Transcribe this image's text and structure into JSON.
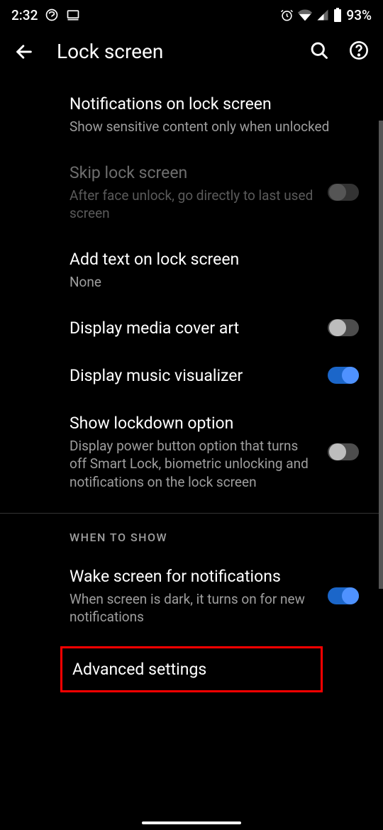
{
  "statusBar": {
    "time": "2:32",
    "battery": "93%"
  },
  "appBar": {
    "title": "Lock screen"
  },
  "settings": {
    "notifications": {
      "title": "Notifications on lock screen",
      "subtitle": "Show sensitive content only when unlocked"
    },
    "skipLock": {
      "title": "Skip lock screen",
      "subtitle": "After face unlock, go directly to last used screen"
    },
    "addText": {
      "title": "Add text on lock screen",
      "subtitle": "None"
    },
    "coverArt": {
      "title": "Display media cover art"
    },
    "musicViz": {
      "title": "Display music visualizer"
    },
    "lockdown": {
      "title": "Show lockdown option",
      "subtitle": "Display power button option that turns off Smart Lock, biometric unlocking and notifications on the lock screen"
    }
  },
  "sectionHeader": "WHEN TO SHOW",
  "wake": {
    "title": "Wake screen for notifications",
    "subtitle": "When screen is dark, it turns on for new notifications"
  },
  "advanced": "Advanced settings"
}
